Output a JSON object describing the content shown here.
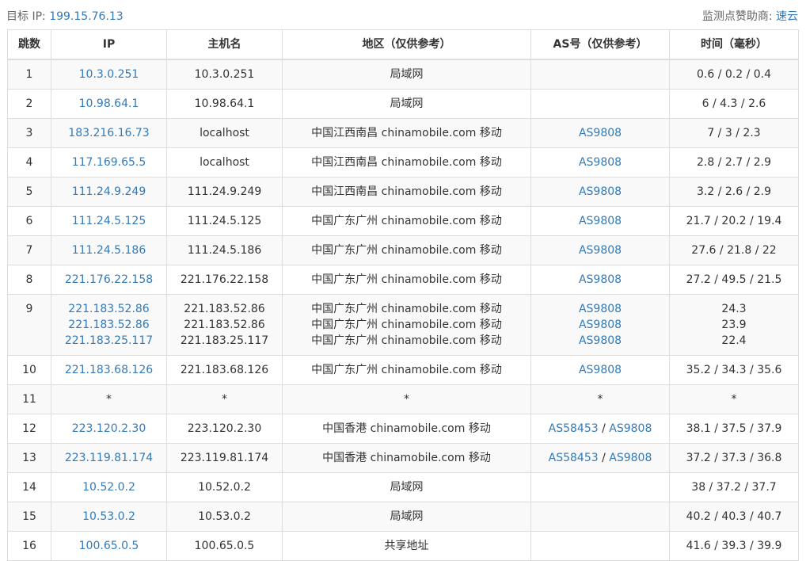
{
  "header": {
    "target_label": "目标 IP:",
    "target_ip": "199.15.76.13",
    "sponsor_label": "监测点赞助商:",
    "sponsor_name": "速云"
  },
  "table": {
    "columns": [
      "跳数",
      "IP",
      "主机名",
      "地区（仅供参考）",
      "AS号（仅供参考）",
      "时间（毫秒）"
    ],
    "rows": [
      {
        "hop": "1",
        "ip": [
          "10.3.0.251"
        ],
        "host": [
          "10.3.0.251"
        ],
        "region": [
          "局域网"
        ],
        "as": [
          []
        ],
        "time": [
          "0.6 / 0.2 / 0.4"
        ]
      },
      {
        "hop": "2",
        "ip": [
          "10.98.64.1"
        ],
        "host": [
          "10.98.64.1"
        ],
        "region": [
          "局域网"
        ],
        "as": [
          []
        ],
        "time": [
          "6 / 4.3 / 2.6"
        ]
      },
      {
        "hop": "3",
        "ip": [
          "183.216.16.73"
        ],
        "host": [
          "localhost"
        ],
        "region": [
          "中国江西南昌 chinamobile.com 移动"
        ],
        "as": [
          [
            "AS9808"
          ]
        ],
        "time": [
          "7 / 3 / 2.3"
        ]
      },
      {
        "hop": "4",
        "ip": [
          "117.169.65.5"
        ],
        "host": [
          "localhost"
        ],
        "region": [
          "中国江西南昌 chinamobile.com 移动"
        ],
        "as": [
          [
            "AS9808"
          ]
        ],
        "time": [
          "2.8 / 2.7 / 2.9"
        ]
      },
      {
        "hop": "5",
        "ip": [
          "111.24.9.249"
        ],
        "host": [
          "111.24.9.249"
        ],
        "region": [
          "中国江西南昌 chinamobile.com 移动"
        ],
        "as": [
          [
            "AS9808"
          ]
        ],
        "time": [
          "3.2 / 2.6 / 2.9"
        ]
      },
      {
        "hop": "6",
        "ip": [
          "111.24.5.125"
        ],
        "host": [
          "111.24.5.125"
        ],
        "region": [
          "中国广东广州 chinamobile.com 移动"
        ],
        "as": [
          [
            "AS9808"
          ]
        ],
        "time": [
          "21.7 / 20.2 / 19.4"
        ]
      },
      {
        "hop": "7",
        "ip": [
          "111.24.5.186"
        ],
        "host": [
          "111.24.5.186"
        ],
        "region": [
          "中国广东广州 chinamobile.com 移动"
        ],
        "as": [
          [
            "AS9808"
          ]
        ],
        "time": [
          "27.6 / 21.8 / 22"
        ]
      },
      {
        "hop": "8",
        "ip": [
          "221.176.22.158"
        ],
        "host": [
          "221.176.22.158"
        ],
        "region": [
          "中国广东广州 chinamobile.com 移动"
        ],
        "as": [
          [
            "AS9808"
          ]
        ],
        "time": [
          "27.2 / 49.5 / 21.5"
        ]
      },
      {
        "hop": "9",
        "ip": [
          "221.183.52.86",
          "221.183.52.86",
          "221.183.25.117"
        ],
        "host": [
          "221.183.52.86",
          "221.183.52.86",
          "221.183.25.117"
        ],
        "region": [
          "中国广东广州 chinamobile.com 移动",
          "中国广东广州 chinamobile.com 移动",
          "中国广东广州 chinamobile.com 移动"
        ],
        "as": [
          [
            "AS9808"
          ],
          [
            "AS9808"
          ],
          [
            "AS9808"
          ]
        ],
        "time": [
          "24.3",
          "23.9",
          "22.4"
        ]
      },
      {
        "hop": "10",
        "ip": [
          "221.183.68.126"
        ],
        "host": [
          "221.183.68.126"
        ],
        "region": [
          "中国广东广州 chinamobile.com 移动"
        ],
        "as": [
          [
            "AS9808"
          ]
        ],
        "time": [
          "35.2 / 34.3 / 35.6"
        ]
      },
      {
        "hop": "11",
        "ip": [
          "*"
        ],
        "host": [
          "*"
        ],
        "region": [
          "*"
        ],
        "as": [
          [
            "*"
          ]
        ],
        "time": [
          "*"
        ],
        "star": true
      },
      {
        "hop": "12",
        "ip": [
          "223.120.2.30"
        ],
        "host": [
          "223.120.2.30"
        ],
        "region": [
          "中国香港 chinamobile.com 移动"
        ],
        "as": [
          [
            "AS58453",
            "AS9808"
          ]
        ],
        "time": [
          "38.1 / 37.5 / 37.9"
        ]
      },
      {
        "hop": "13",
        "ip": [
          "223.119.81.174"
        ],
        "host": [
          "223.119.81.174"
        ],
        "region": [
          "中国香港 chinamobile.com 移动"
        ],
        "as": [
          [
            "AS58453",
            "AS9808"
          ]
        ],
        "time": [
          "37.2 / 37.3 / 36.8"
        ]
      },
      {
        "hop": "14",
        "ip": [
          "10.52.0.2"
        ],
        "host": [
          "10.52.0.2"
        ],
        "region": [
          "局域网"
        ],
        "as": [
          []
        ],
        "time": [
          "38 / 37.2 / 37.7"
        ]
      },
      {
        "hop": "15",
        "ip": [
          "10.53.0.2"
        ],
        "host": [
          "10.53.0.2"
        ],
        "region": [
          "局域网"
        ],
        "as": [
          []
        ],
        "time": [
          "40.2 / 40.3 / 40.7"
        ]
      },
      {
        "hop": "16",
        "ip": [
          "100.65.0.5"
        ],
        "host": [
          "100.65.0.5"
        ],
        "region": [
          "共享地址"
        ],
        "as": [
          []
        ],
        "time": [
          "41.6 / 39.3 / 39.9"
        ]
      }
    ]
  },
  "colors": {
    "link": "#337ab7",
    "border": "#dddddd",
    "stripe": "#f9f9f9"
  }
}
